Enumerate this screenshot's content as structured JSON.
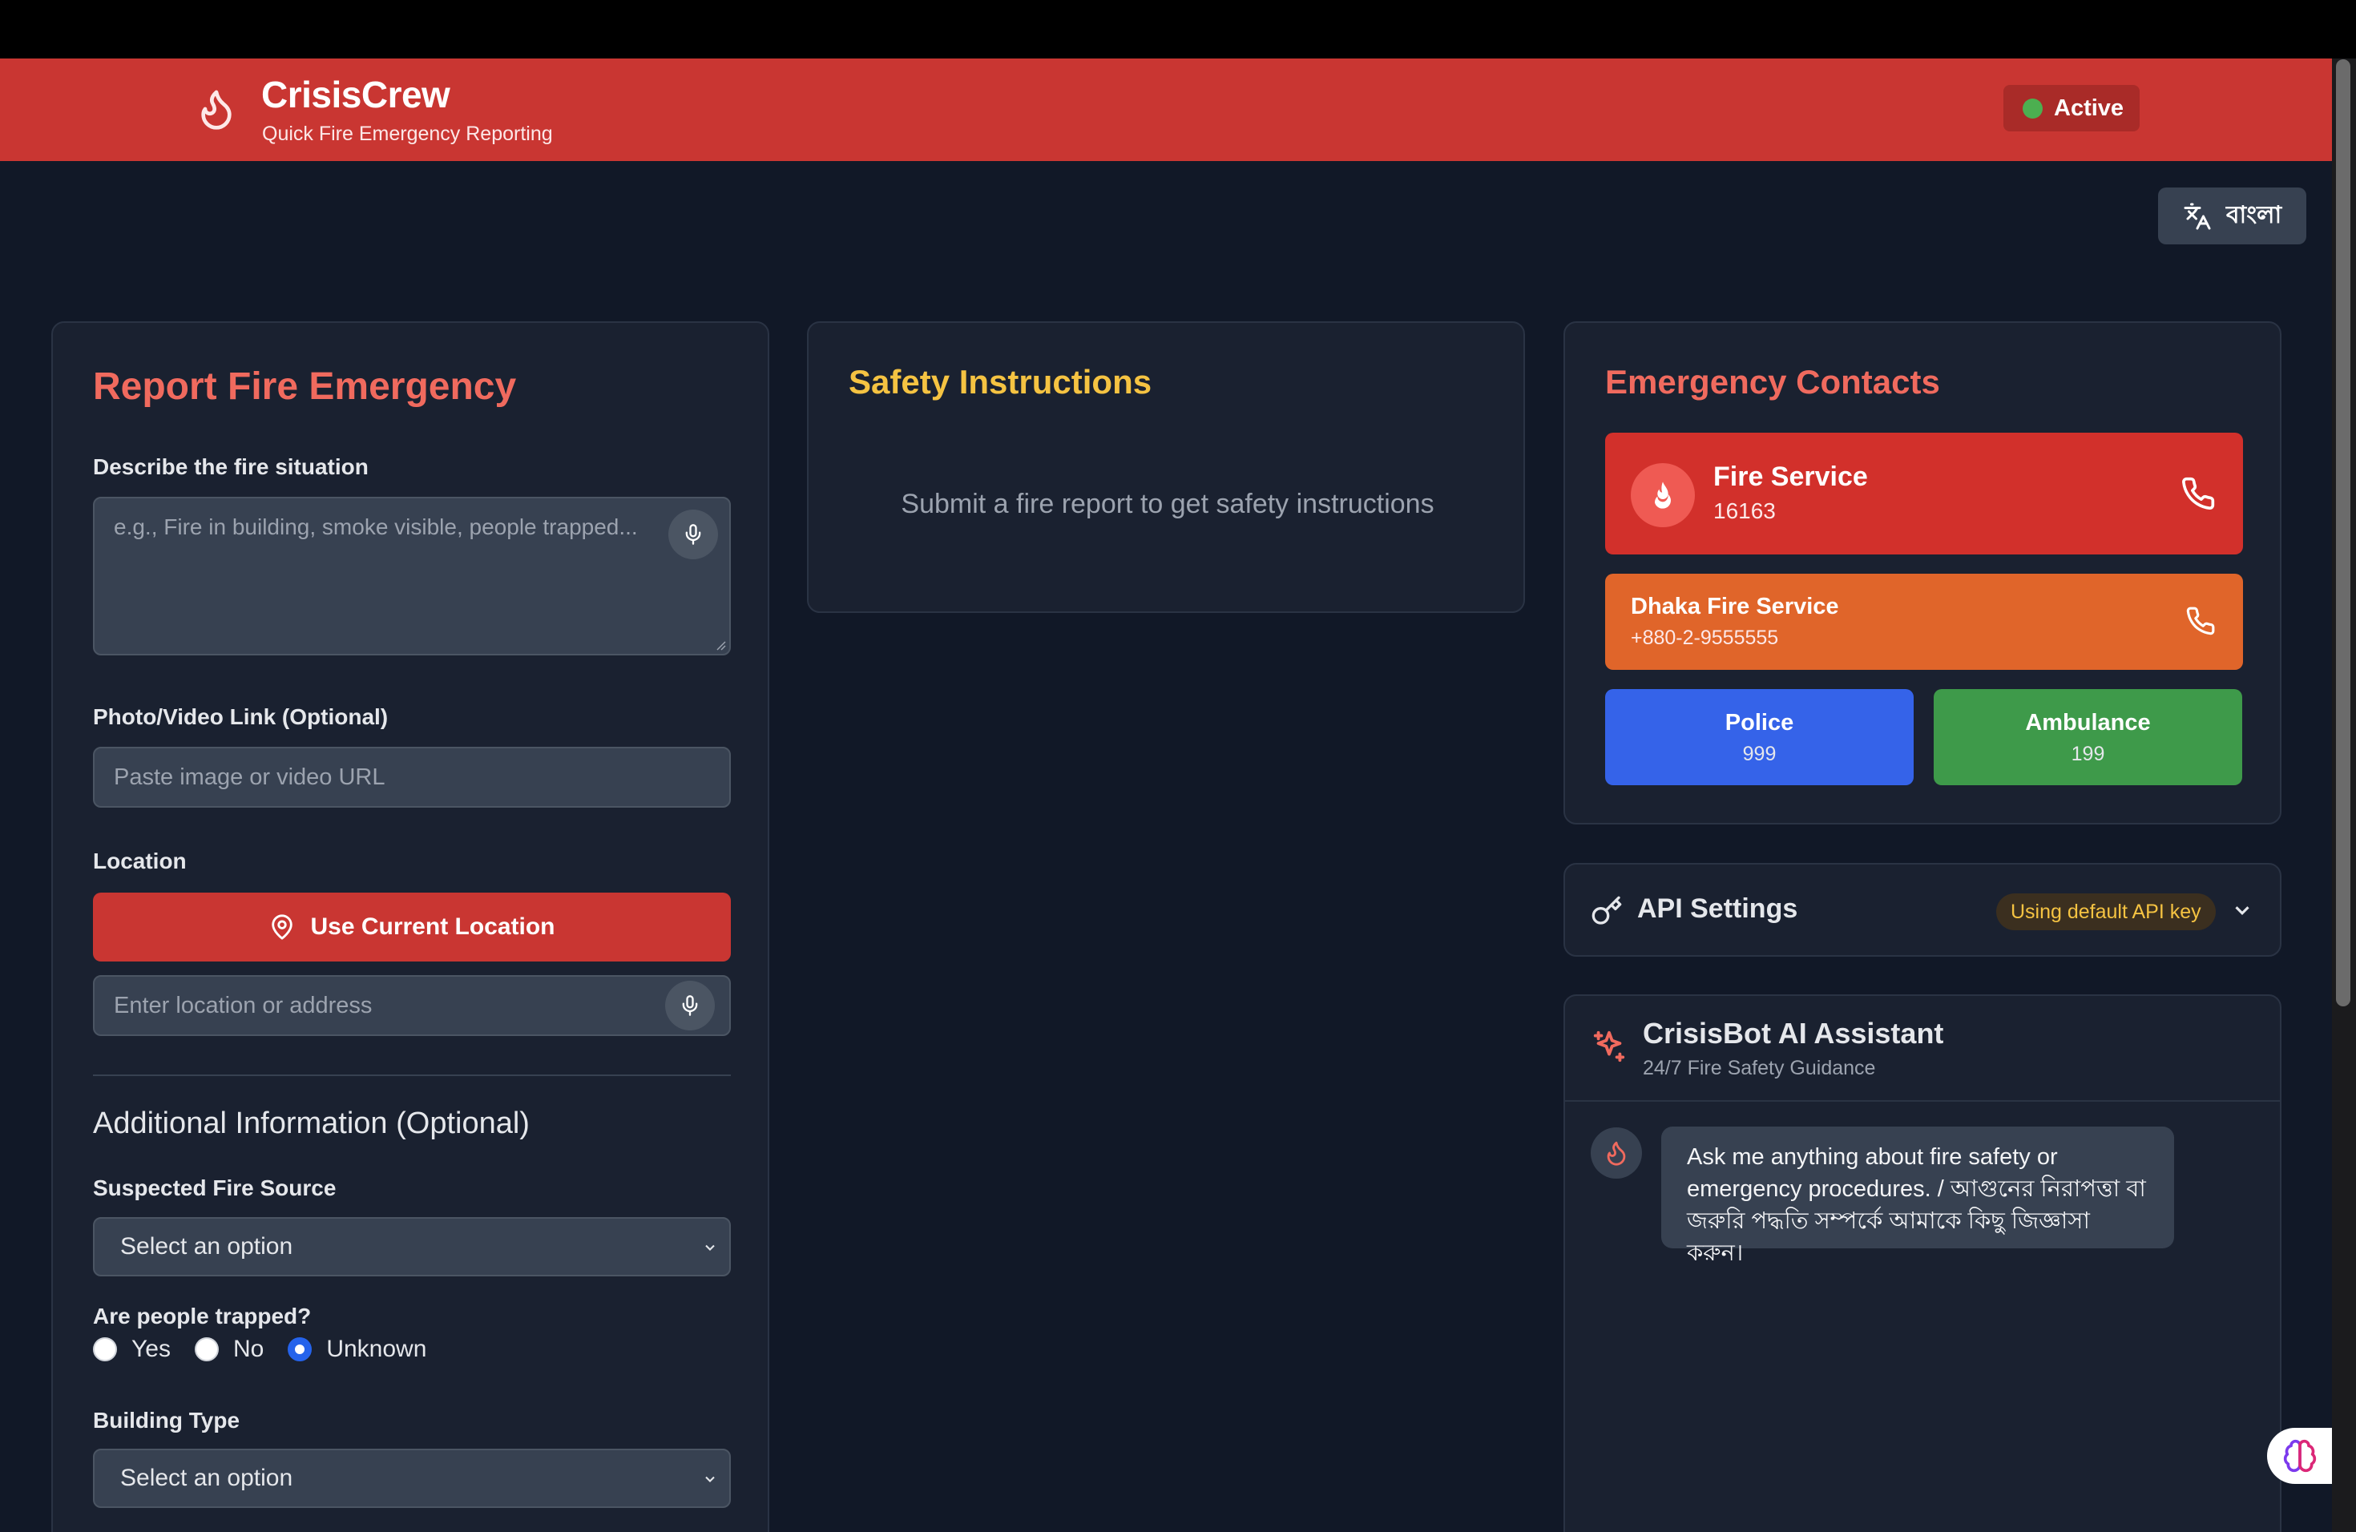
{
  "header": {
    "brand": "CrisisCrew",
    "tagline": "Quick Fire Emergency Reporting",
    "status": "Active"
  },
  "language_toggle": {
    "label": "বাংলা",
    "icon": "translate-icon"
  },
  "report": {
    "title": "Report Fire Emergency",
    "description_label": "Describe the fire situation",
    "description_placeholder": "e.g., Fire in building, smoke visible, people trapped...",
    "media_label": "Photo/Video Link (Optional)",
    "media_placeholder": "Paste image or video URL",
    "location_label": "Location",
    "use_location_button": "Use Current Location",
    "location_placeholder": "Enter location or address",
    "additional_title": "Additional Information (Optional)",
    "fire_source_label": "Suspected Fire Source",
    "fire_source_value": "Select an option",
    "trapped_label": "Are people trapped?",
    "trapped_options": [
      "Yes",
      "No",
      "Unknown"
    ],
    "trapped_selected": "Unknown",
    "building_label": "Building Type",
    "building_value": "Select an option"
  },
  "safety": {
    "title": "Safety Instructions",
    "empty_text": "Submit a fire report to get safety instructions"
  },
  "contacts": {
    "title": "Emergency Contacts",
    "fire_service": {
      "name": "Fire Service",
      "number": "16163"
    },
    "dhaka_fire": {
      "name": "Dhaka Fire Service",
      "number": "+880-2-9555555"
    },
    "police": {
      "name": "Police",
      "number": "999"
    },
    "ambulance": {
      "name": "Ambulance",
      "number": "199"
    }
  },
  "api_settings": {
    "title": "API Settings",
    "badge": "Using default API key"
  },
  "chatbot": {
    "title": "CrisisBot AI Assistant",
    "subtitle": "24/7 Fire Safety Guidance",
    "message": "Ask me anything about fire safety or emergency procedures. / আগুনের নিরাপত্তা বা জরুরি পদ্ধতি সম্পর্কে আমাকে কিছু জিজ্ঞাসা করুন।"
  },
  "colors": {
    "header": "#c93632",
    "background": "#111827",
    "card": "#1a2130",
    "accent_red": "#f06a5e",
    "accent_yellow": "#f5c342",
    "orange": "#e0652a",
    "blue": "#3563e9",
    "green": "#3e9a4a"
  }
}
